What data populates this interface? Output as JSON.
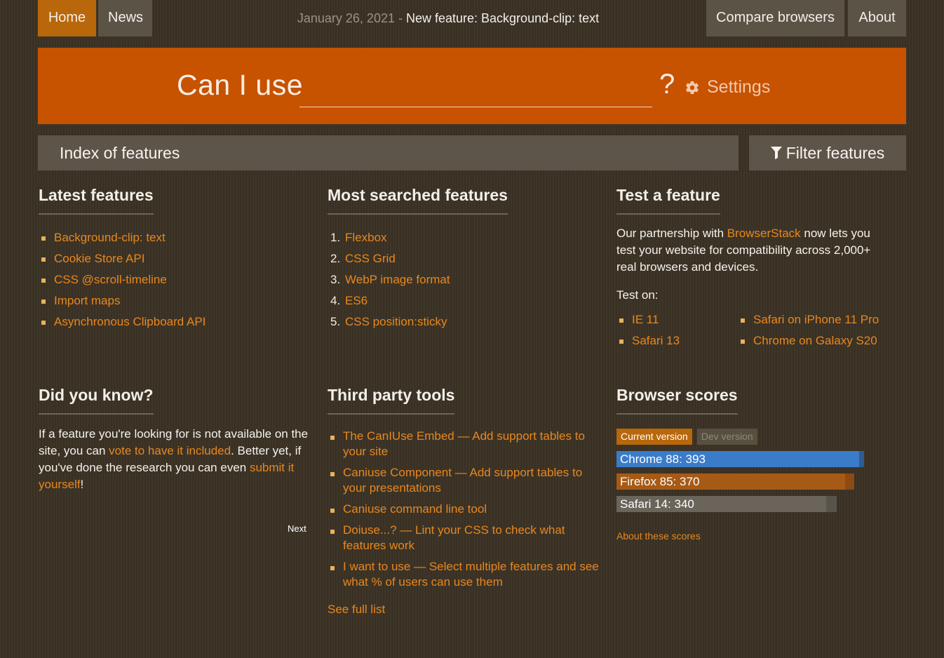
{
  "nav": {
    "home": "Home",
    "news": "News",
    "compare": "Compare browsers",
    "about": "About"
  },
  "announcement": {
    "date": "January 26, 2021",
    "separator": " - ",
    "headline": "New feature: Background-clip: text"
  },
  "hero": {
    "title": "Can I use",
    "search_value": "",
    "question_mark": "?",
    "settings_label": "Settings"
  },
  "index_bar": {
    "title": "Index of features",
    "filter_label": "Filter features"
  },
  "latest": {
    "title": "Latest features",
    "items": [
      "Background-clip: text",
      "Cookie Store API",
      "CSS @scroll-timeline",
      "Import maps",
      "Asynchronous Clipboard API"
    ]
  },
  "most_searched": {
    "title": "Most searched features",
    "items": [
      "Flexbox",
      "CSS Grid",
      "WebP image format",
      "ES6",
      "CSS position:sticky"
    ]
  },
  "test": {
    "title": "Test a feature",
    "intro_before": "Our partnership with ",
    "intro_link": "BrowserStack",
    "intro_after": " now lets you test your website for compatibility across 2,000+ real browsers and devices.",
    "test_on": "Test on:",
    "left_items": [
      "IE 11",
      "Safari 13"
    ],
    "right_items": [
      "Safari on iPhone 11 Pro",
      "Chrome on Galaxy S20"
    ]
  },
  "did_you_know": {
    "title": "Did you know?",
    "text_1": "If a feature you're looking for is not available on the site, you can ",
    "link_1": "vote to have it included",
    "text_2": ". Better yet, if you've done the research you can even ",
    "link_2": "submit it yourself",
    "text_3": "!",
    "next": "Next"
  },
  "third_party": {
    "title": "Third party tools",
    "items": [
      "The CanIUse Embed — Add support tables to your site",
      "Caniuse Component — Add support tables to your presentations",
      "Caniuse command line tool",
      "Doiuse...? — Lint your CSS to check what features work",
      "I want to use — Select multiple features and see what % of users can use them"
    ],
    "see_full": "See full list"
  },
  "scores": {
    "title": "Browser scores",
    "tab_current": "Current version",
    "tab_dev": "Dev version",
    "bars": [
      {
        "label": "Chrome 88: 393",
        "score": 393,
        "dev_score": 401,
        "color": "#3b7cc9",
        "extra_color": "#2f5d91"
      },
      {
        "label": "Firefox 85: 370",
        "score": 370,
        "dev_score": 385,
        "color": "#a65a16",
        "extra_color": "#8b4b12"
      },
      {
        "label": "Safari 14: 340",
        "score": 340,
        "dev_score": 357,
        "color": "#6a645b",
        "extra_color": "#58534b"
      }
    ],
    "scale_max": 401,
    "about_link": "About these scores"
  },
  "colors": {
    "accent": "#c75200",
    "link": "#e8871e",
    "nav_active": "#b8670a"
  }
}
